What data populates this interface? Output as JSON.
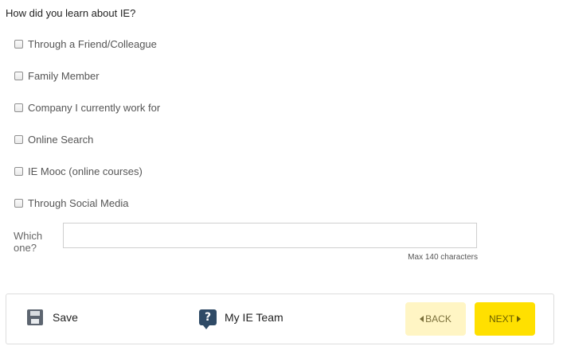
{
  "question": "How did you learn about IE?",
  "options": [
    {
      "label": "Through a Friend/Colleague",
      "checked": false
    },
    {
      "label": "Family Member",
      "checked": false
    },
    {
      "label": "Company I currently work for",
      "checked": false
    },
    {
      "label": "Online Search",
      "checked": false
    },
    {
      "label": "IE Mooc (online courses)",
      "checked": false
    },
    {
      "label": "Through Social Media",
      "checked": false
    }
  ],
  "which": {
    "label": "Which one?",
    "value": "",
    "hint": "Max 140 characters"
  },
  "footer": {
    "save_label": "Save",
    "team_label": "My IE Team",
    "help_icon_glyph": "?",
    "back_label": "BACK",
    "next_label": "NEXT"
  },
  "colors": {
    "back_bg": "#fff5c4",
    "next_bg": "#ffe000",
    "help_icon": "#2f4a66"
  },
  "icons": {
    "save": "floppy-disk-icon",
    "team": "help-question-icon",
    "back": "caret-left-icon",
    "next": "caret-right-icon"
  }
}
